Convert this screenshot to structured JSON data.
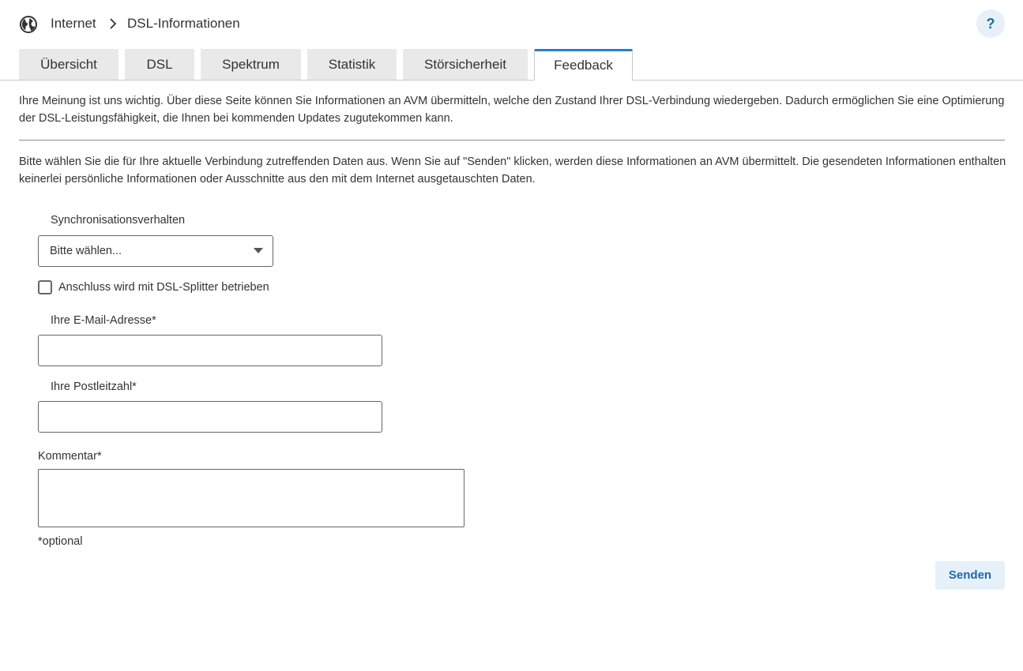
{
  "breadcrumb": {
    "icon": "globe-icon",
    "items": [
      "Internet",
      "DSL-Informationen"
    ]
  },
  "help": {
    "label": "?"
  },
  "tabs": [
    {
      "label": "Übersicht",
      "active": false
    },
    {
      "label": "DSL",
      "active": false
    },
    {
      "label": "Spektrum",
      "active": false
    },
    {
      "label": "Statistik",
      "active": false
    },
    {
      "label": "Störsicherheit",
      "active": false
    },
    {
      "label": "Feedback",
      "active": true
    }
  ],
  "intro": {
    "text1": "Ihre Meinung ist uns wichtig. Über diese Seite können Sie Informationen an AVM übermitteln, welche den Zustand Ihrer DSL-Verbindung wiedergeben. Dadurch ermöglichen Sie eine Optimierung der DSL-Leistungsfähigkeit, die Ihnen bei kommenden Updates zugutekommen kann.",
    "text2": "Bitte wählen Sie die für Ihre aktuelle Verbindung zutreffenden Daten aus. Wenn Sie auf \"Senden\" klicken, werden diese Informationen an AVM übermittelt. Die gesendeten Informationen enthalten keinerlei persönliche Informationen oder Ausschnitte aus den mit dem Internet ausgetauschten Daten."
  },
  "form": {
    "sync_label": "Synchronisationsverhalten",
    "sync_selected": "Bitte wählen...",
    "splitter_label": "Anschluss wird mit DSL-Splitter betrieben",
    "splitter_checked": false,
    "email_label": "Ihre E-Mail-Adresse*",
    "email_value": "",
    "plz_label": "Ihre Postleitzahl*",
    "plz_value": "",
    "comment_label": "Kommentar*",
    "comment_value": "",
    "optional_note": "*optional",
    "send_label": "Senden"
  },
  "colors": {
    "accent": "#2a7fc9",
    "button_bg": "#e6f0f8",
    "button_text": "#1f69a6"
  }
}
